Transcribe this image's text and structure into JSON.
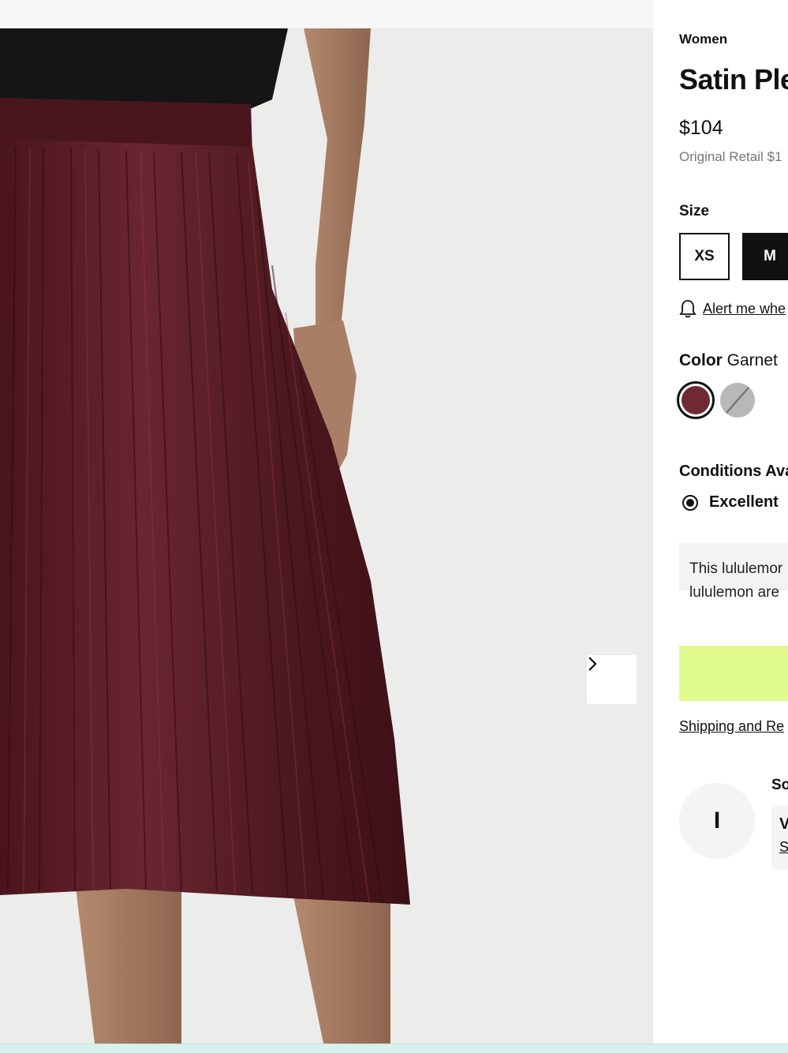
{
  "product": {
    "category": "Women",
    "title": "Satin Ple",
    "price": "$104",
    "original_retail": "Original Retail $1"
  },
  "size": {
    "label": "Size",
    "options": [
      "XS",
      "M"
    ],
    "selected": "M",
    "alert_link": "Alert me whe"
  },
  "color": {
    "label": "Color",
    "selected_name": "Garnet",
    "swatches": [
      {
        "name": "Garnet",
        "hex": "#6e2a30",
        "selected": true
      },
      {
        "name": "grey-unavailable",
        "hex": "#b8b8b8",
        "selected": false
      }
    ]
  },
  "conditions": {
    "label": "Conditions Ava",
    "options": [
      "Excellent"
    ],
    "selected": "Excellent"
  },
  "info": {
    "line1": "This lululemor",
    "line2": "lululemon are"
  },
  "shipping_link": "Shipping and Re",
  "seller": {
    "heading": "So",
    "avatar_initial": "I",
    "name": "V",
    "link": "S"
  },
  "gallery": {
    "next_icon": "chevron-right-icon",
    "skirt_color": "#5a1d26"
  },
  "colors": {
    "cta_bg": "#e1fa8e",
    "text": "#111111",
    "bottom_strip": "#d7f1ee"
  }
}
